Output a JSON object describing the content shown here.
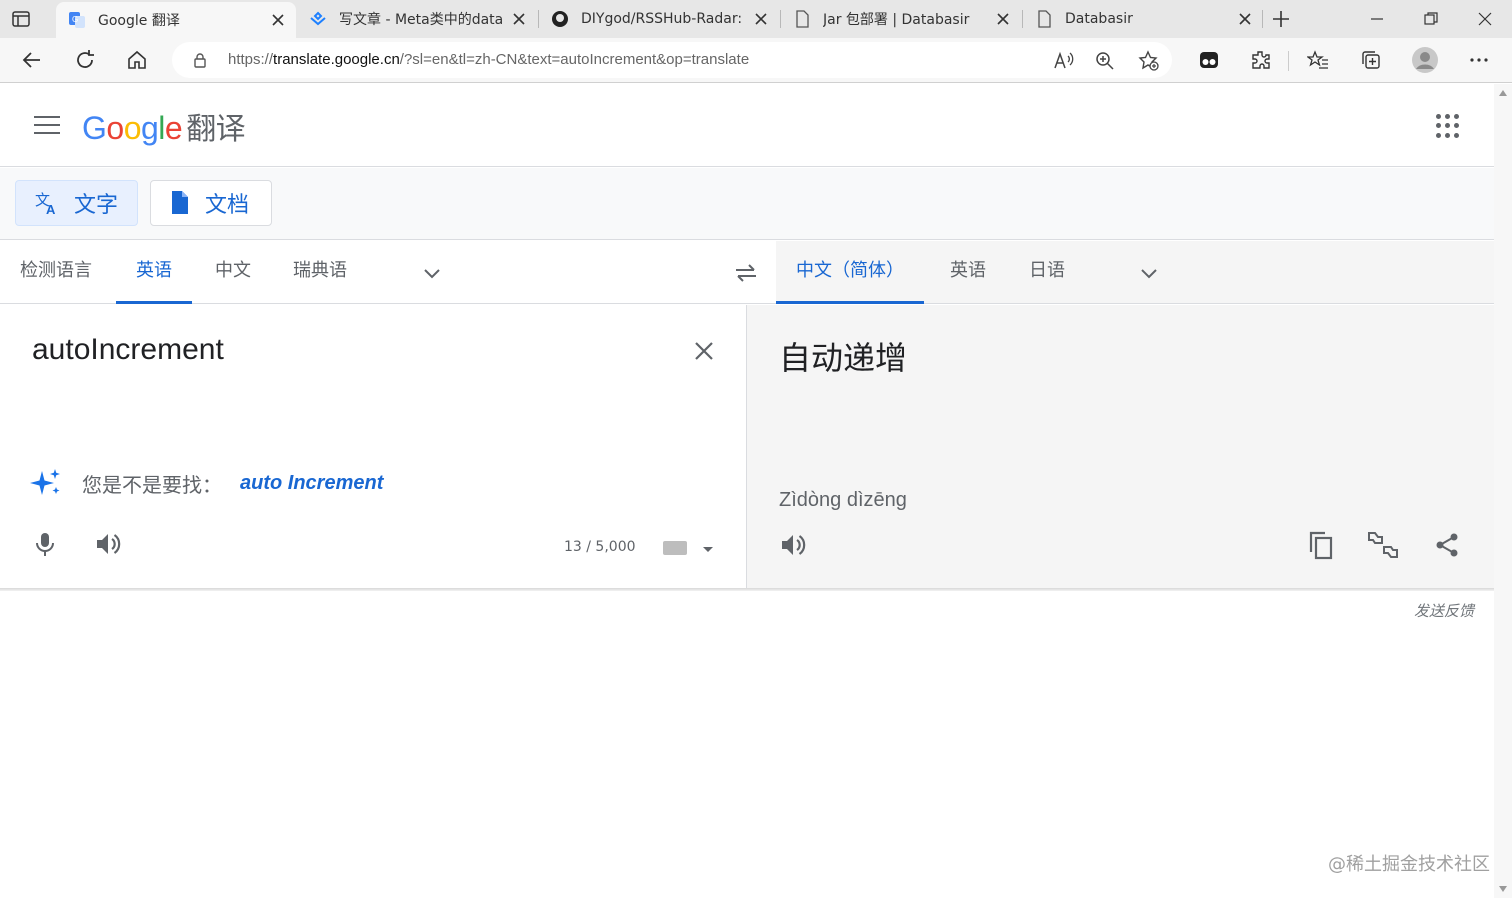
{
  "browser": {
    "tabs": [
      {
        "label": "Google 翻译",
        "active": true,
        "icon": "google-translate-favicon"
      },
      {
        "label": "写文章 - Meta类中的data",
        "active": false,
        "icon": "juejin-favicon"
      },
      {
        "label": "DIYgod/RSSHub-Radar: 🍰",
        "active": false,
        "icon": "github-favicon"
      },
      {
        "label": "Jar 包部署 | Databasir",
        "active": false,
        "icon": "page-favicon"
      },
      {
        "label": "Databasir",
        "active": false,
        "icon": "page-favicon"
      }
    ],
    "url_prefix": "https://",
    "url_host": "translate.google.cn",
    "url_path": "/?sl=en&tl=zh-CN&text=autoIncrement&op=translate"
  },
  "header": {
    "logo_letters": [
      "G",
      "o",
      "o",
      "g",
      "l",
      "e"
    ],
    "logo_colors": [
      "#4285F4",
      "#EA4335",
      "#FBBC05",
      "#4285F4",
      "#34A853",
      "#EA4335"
    ],
    "product": "翻译"
  },
  "modes": [
    {
      "label": "文字",
      "icon": "translate-icon",
      "active": true
    },
    {
      "label": "文档",
      "icon": "document-icon",
      "active": false
    }
  ],
  "source_langs": [
    "检测语言",
    "英语",
    "中文",
    "瑞典语"
  ],
  "target_langs": [
    "中文（简体）",
    "英语",
    "日语"
  ],
  "source": {
    "text": "autoIncrement",
    "suggestion_prompt": "您是不是要找：",
    "suggestion": "auto Increment",
    "char_count": "13 / 5,000"
  },
  "target": {
    "text": "自动递增",
    "pinyin": "Zìdòng dìzēng"
  },
  "feedback": "发送反馈",
  "watermark": "@稀土掘金技术社区",
  "colors": {
    "accent": "#1967d2",
    "selected_bg": "#e8f0fe",
    "panel_bg": "#f5f5f5"
  }
}
